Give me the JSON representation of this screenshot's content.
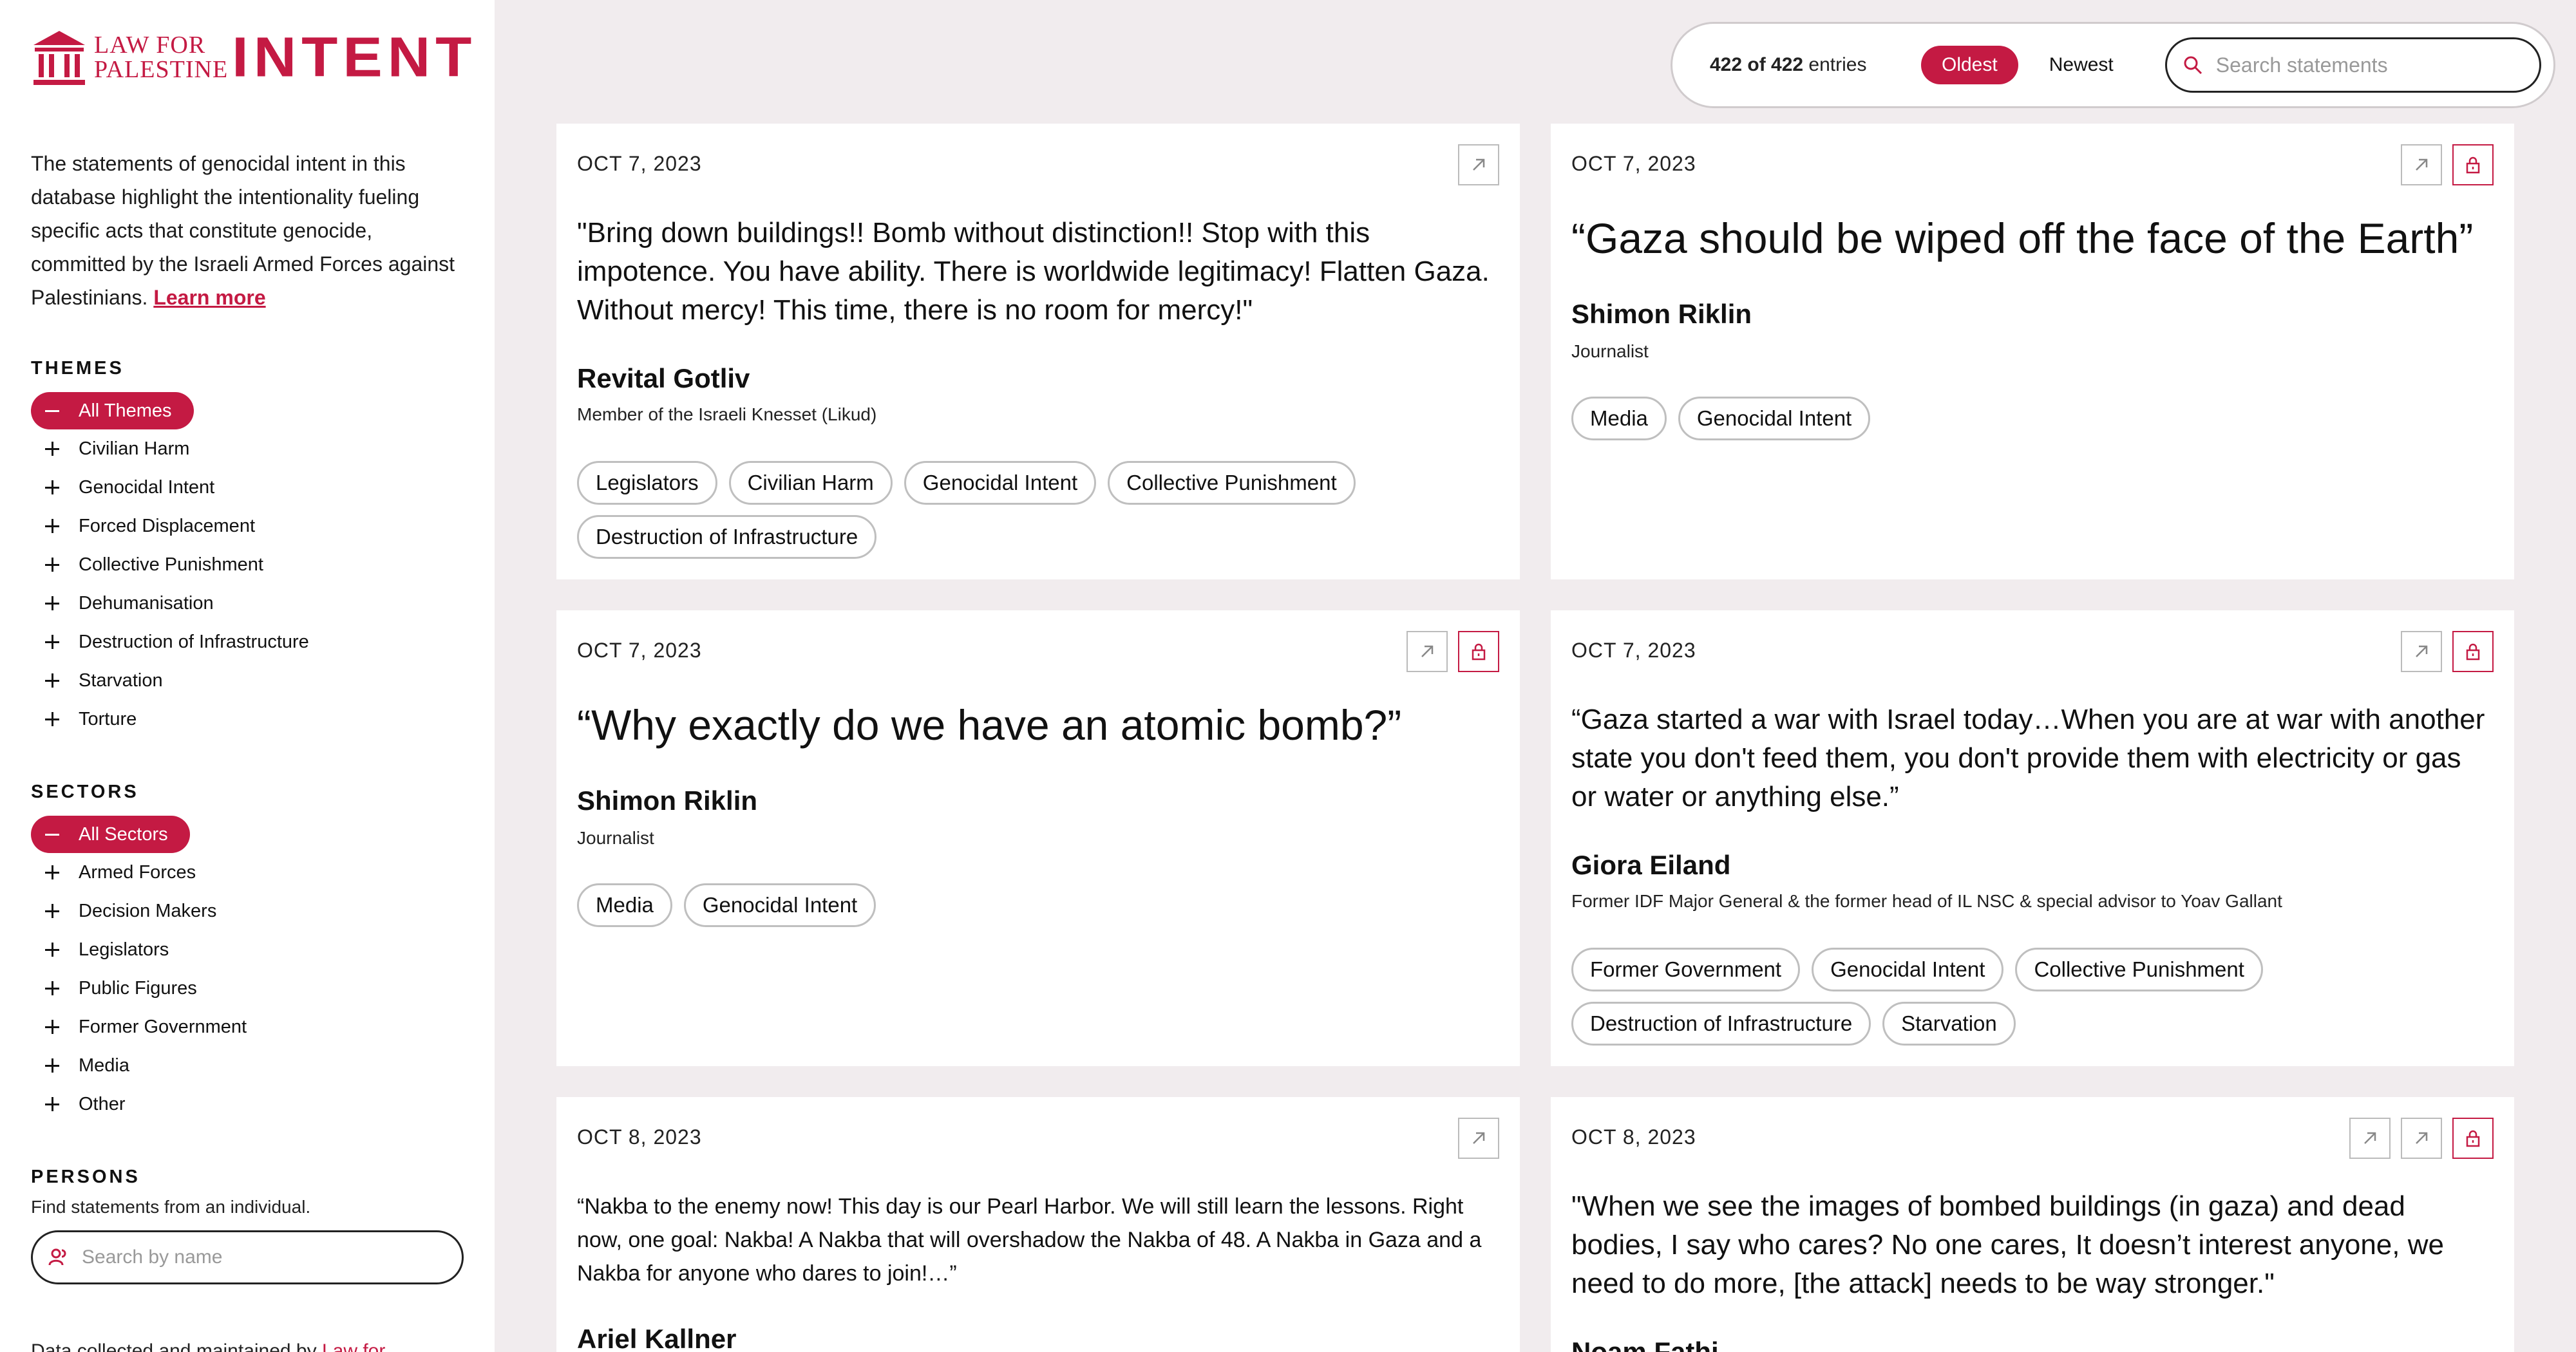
{
  "brand": {
    "small_line1": "LAW FOR",
    "small_line2": "PALESTINE",
    "big": "INTENT"
  },
  "intro": {
    "text": "The statements of genocidal intent in this database highlight the intentionality fueling specific acts that constitute genocide, committed by the Israeli Armed Forces against Palestinians.",
    "link": "Learn more"
  },
  "themes": {
    "title": "THEMES",
    "all_label": "All Themes",
    "items": [
      "Civilian Harm",
      "Genocidal Intent",
      "Forced Displacement",
      "Collective Punishment",
      "Dehumanisation",
      "Destruction of Infrastructure",
      "Starvation",
      "Torture"
    ]
  },
  "sectors": {
    "title": "SECTORS",
    "all_label": "All Sectors",
    "items": [
      "Armed Forces",
      "Decision Makers",
      "Legislators",
      "Public Figures",
      "Former Government",
      "Media",
      "Other"
    ]
  },
  "persons": {
    "title": "PERSONS",
    "subtitle": "Find statements from an individual.",
    "search_placeholder": "Search by name"
  },
  "footer": {
    "text": "Data collected and maintained by",
    "link": "Law for"
  },
  "topbar": {
    "count_bold": "422 of 422",
    "count_suffix": " entries",
    "oldest": "Oldest",
    "newest": "Newest",
    "search_placeholder": "Search statements"
  },
  "cards": [
    {
      "date": "OCT 7, 2023",
      "quote": "\"Bring down buildings!! Bomb without distinction!! Stop with this impotence. You have ability. There is worldwide legitimacy! Flatten Gaza. Without mercy! This time, there is no room for mercy!\"",
      "name": "Revital Gotliv",
      "role": "Member of the Israeli Knesset (Likud)",
      "tags": [
        "Legislators",
        "Civilian Harm",
        "Genocidal Intent",
        "Collective Punishment",
        "Destruction of Infrastructure"
      ],
      "icons": [
        "external-link-icon"
      ]
    },
    {
      "date": "OCT 7, 2023",
      "quote": "“Gaza should be wiped off the face of the Earth”",
      "name": "Shimon Riklin",
      "role": "Journalist",
      "tags": [
        "Media",
        "Genocidal Intent"
      ],
      "icons": [
        "external-link-icon",
        "lock-icon"
      ]
    },
    {
      "date": "OCT 7, 2023",
      "quote": "“Why exactly do we have an atomic bomb?”",
      "name": "Shimon Riklin",
      "role": "Journalist",
      "tags": [
        "Media",
        "Genocidal Intent"
      ],
      "icons": [
        "external-link-icon",
        "lock-icon"
      ]
    },
    {
      "date": "OCT 7, 2023",
      "quote": "“Gaza started a war with Israel today…When you are at war with another state you don't feed them, you don't provide them with electricity or gas or water or anything else.”",
      "name": "Giora Eiland",
      "role": "Former IDF Major General & the former head of IL NSC & special advisor to Yoav Gallant",
      "tags": [
        "Former Government",
        "Genocidal Intent",
        "Collective Punishment",
        "Destruction of Infrastructure",
        "Starvation"
      ],
      "icons": [
        "external-link-icon",
        "lock-icon"
      ]
    },
    {
      "date": "OCT 8, 2023",
      "quote": "“Nakba to the enemy now! This day is our Pearl Harbor. We will still learn the lessons. Right now, one goal: Nakba! A Nakba that will overshadow the Nakba of 48. A Nakba in Gaza and a Nakba for anyone who dares to join!…”",
      "name": "Ariel Kallner",
      "role": "",
      "tags": [],
      "icons": [
        "external-link-icon"
      ]
    },
    {
      "date": "OCT 8, 2023",
      "quote": "\"When we see the images of bombed buildings (in gaza) and dead bodies, I say who cares? No one cares, It doesn’t interest anyone, we need to do more, [the attack] needs to be way stronger.\"",
      "name": "Noam Fathi",
      "role": "",
      "tags": [],
      "icons": [
        "external-link-icon",
        "external-link-icon",
        "lock-icon"
      ]
    }
  ]
}
